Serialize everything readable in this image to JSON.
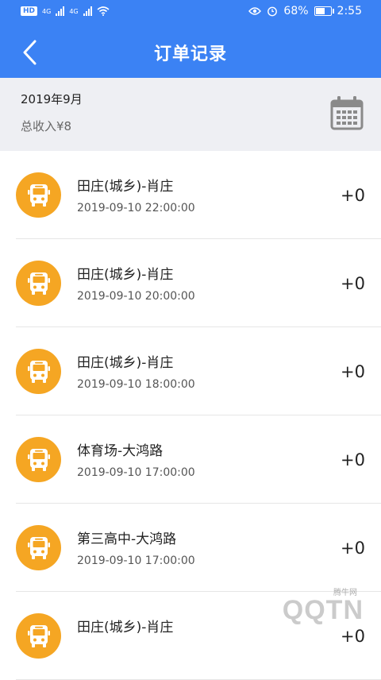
{
  "status_bar": {
    "hd_badge": "HD",
    "network_1": "4G",
    "network_2": "4G",
    "battery_percent": "68%",
    "battery_level": 0.68,
    "time": "2:55"
  },
  "header": {
    "title": "订单记录",
    "back_icon": "chevron-left-icon"
  },
  "summary": {
    "month": "2019年9月",
    "total_income": "总收入¥8",
    "calendar_icon": "calendar-icon"
  },
  "orders": [
    {
      "route": "田庄(城乡)-肖庄",
      "time": "2019-09-10 22:00:00",
      "amount": "+0",
      "icon": "bus-icon"
    },
    {
      "route": "田庄(城乡)-肖庄",
      "time": "2019-09-10 20:00:00",
      "amount": "+0",
      "icon": "bus-icon"
    },
    {
      "route": "田庄(城乡)-肖庄",
      "time": "2019-09-10 18:00:00",
      "amount": "+0",
      "icon": "bus-icon"
    },
    {
      "route": "体育场-大鸿路",
      "time": "2019-09-10 17:00:00",
      "amount": "+0",
      "icon": "bus-icon"
    },
    {
      "route": "第三高中-大鸿路",
      "time": "2019-09-10 17:00:00",
      "amount": "+0",
      "icon": "bus-icon"
    },
    {
      "route": "田庄(城乡)-肖庄",
      "time": "",
      "amount": "+0",
      "icon": "bus-icon"
    }
  ],
  "watermark": {
    "brand": "QQTN",
    "sub": "腾牛网"
  },
  "colors": {
    "header_bg": "#3b82f4",
    "summary_bg": "#eeeff3",
    "icon_bg": "#f5a623"
  }
}
